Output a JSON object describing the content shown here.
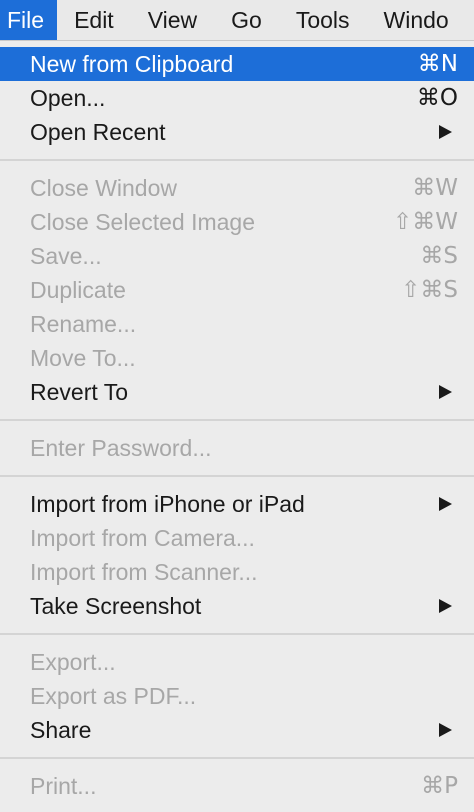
{
  "menubar": {
    "file": "File",
    "edit": "Edit",
    "view": "View",
    "go": "Go",
    "tools": "Tools",
    "window": "Windo"
  },
  "menu": {
    "new_from_clipboard": {
      "label": "New from Clipboard",
      "shortcut": "⌘N"
    },
    "open": {
      "label": "Open...",
      "shortcut": "⌘O"
    },
    "open_recent": {
      "label": "Open Recent"
    },
    "close_window": {
      "label": "Close Window",
      "shortcut": "⌘W"
    },
    "close_selected_image": {
      "label": "Close Selected Image",
      "shortcut": "⇧⌘W"
    },
    "save": {
      "label": "Save...",
      "shortcut": "⌘S"
    },
    "duplicate": {
      "label": "Duplicate",
      "shortcut": "⇧⌘S"
    },
    "rename": {
      "label": "Rename..."
    },
    "move_to": {
      "label": "Move To..."
    },
    "revert_to": {
      "label": "Revert To"
    },
    "enter_password": {
      "label": "Enter Password..."
    },
    "import_iphone": {
      "label": "Import from iPhone or iPad"
    },
    "import_camera": {
      "label": "Import from Camera..."
    },
    "import_scanner": {
      "label": "Import from Scanner..."
    },
    "take_screenshot": {
      "label": "Take Screenshot"
    },
    "export": {
      "label": "Export..."
    },
    "export_pdf": {
      "label": "Export as PDF..."
    },
    "share": {
      "label": "Share"
    },
    "print": {
      "label": "Print...",
      "shortcut": "⌘P"
    }
  },
  "colors": {
    "accent": "#1d6ed8",
    "disabled_text": "#a7a7a7",
    "menu_background": "#ececec"
  },
  "icons": {
    "submenu": "chevron-right-icon"
  }
}
